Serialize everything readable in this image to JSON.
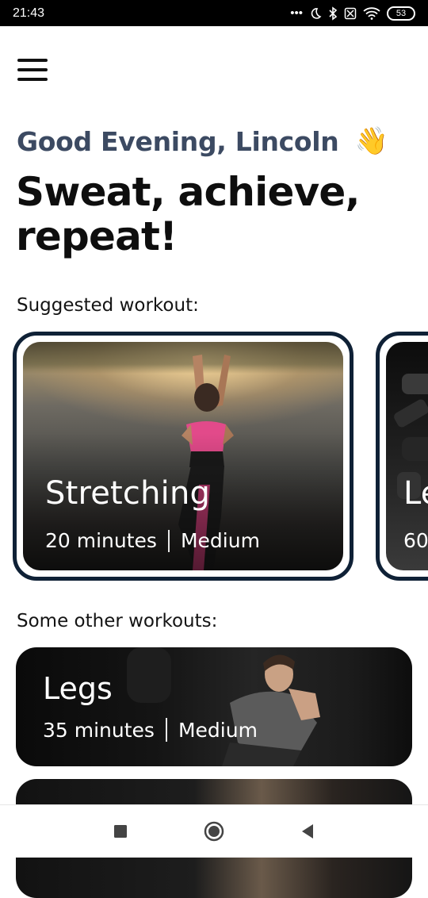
{
  "status_bar": {
    "time": "21:43",
    "battery": "53",
    "icons": [
      "more-dots-icon",
      "moon-icon",
      "bluetooth-icon",
      "sim-off-icon",
      "wifi-icon",
      "battery-icon"
    ]
  },
  "header": {
    "menu_icon": "hamburger-menu-icon"
  },
  "greeting": {
    "text": "Good Evening, Lincoln",
    "emoji": "👋"
  },
  "headline": "Sweat, achieve, repeat!",
  "suggested": {
    "label": "Suggested workout:",
    "cards": [
      {
        "title": "Stretching",
        "duration": "20 minutes",
        "difficulty": "Medium"
      },
      {
        "title": "Le",
        "duration": "60"
      }
    ]
  },
  "other": {
    "label": "Some other workouts:",
    "cards": [
      {
        "title": "Legs",
        "duration": "35 minutes",
        "difficulty": "Medium"
      }
    ]
  },
  "nav_bar": {
    "icons": [
      "recent-apps-icon",
      "home-icon",
      "back-icon"
    ]
  },
  "colors": {
    "card_border": "#0f2136",
    "greeting": "#3c4a62",
    "headline": "#0e0e0e"
  }
}
